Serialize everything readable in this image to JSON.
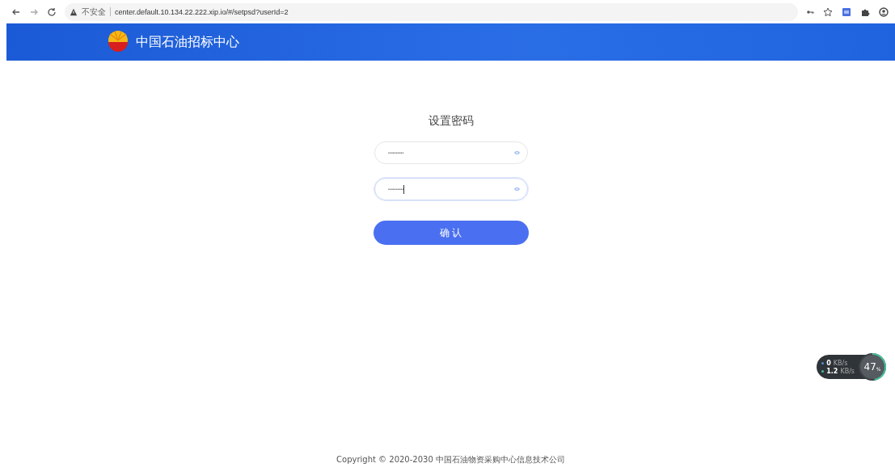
{
  "browser": {
    "security_label": "不安全",
    "url": "center.default.10.134.22.222.xip.io/#/setpsd?userId=2"
  },
  "header": {
    "title": "中国石油招标中心"
  },
  "form": {
    "title": "设置密码",
    "fields": [
      {
        "value": "••••••••••",
        "focused": false
      },
      {
        "value": "••••••••••",
        "focused": true
      }
    ],
    "submit": "确 认"
  },
  "speed_widget": {
    "upload": "0",
    "upload_unit": "KB/s",
    "download": "1.2",
    "download_unit": "KB/s",
    "percent": "47",
    "percent_unit": "%",
    "level": 0.47
  },
  "footer": {
    "copyright": "Copyright © 2020-2030 中国石油物资采购中心信息技术公司"
  }
}
